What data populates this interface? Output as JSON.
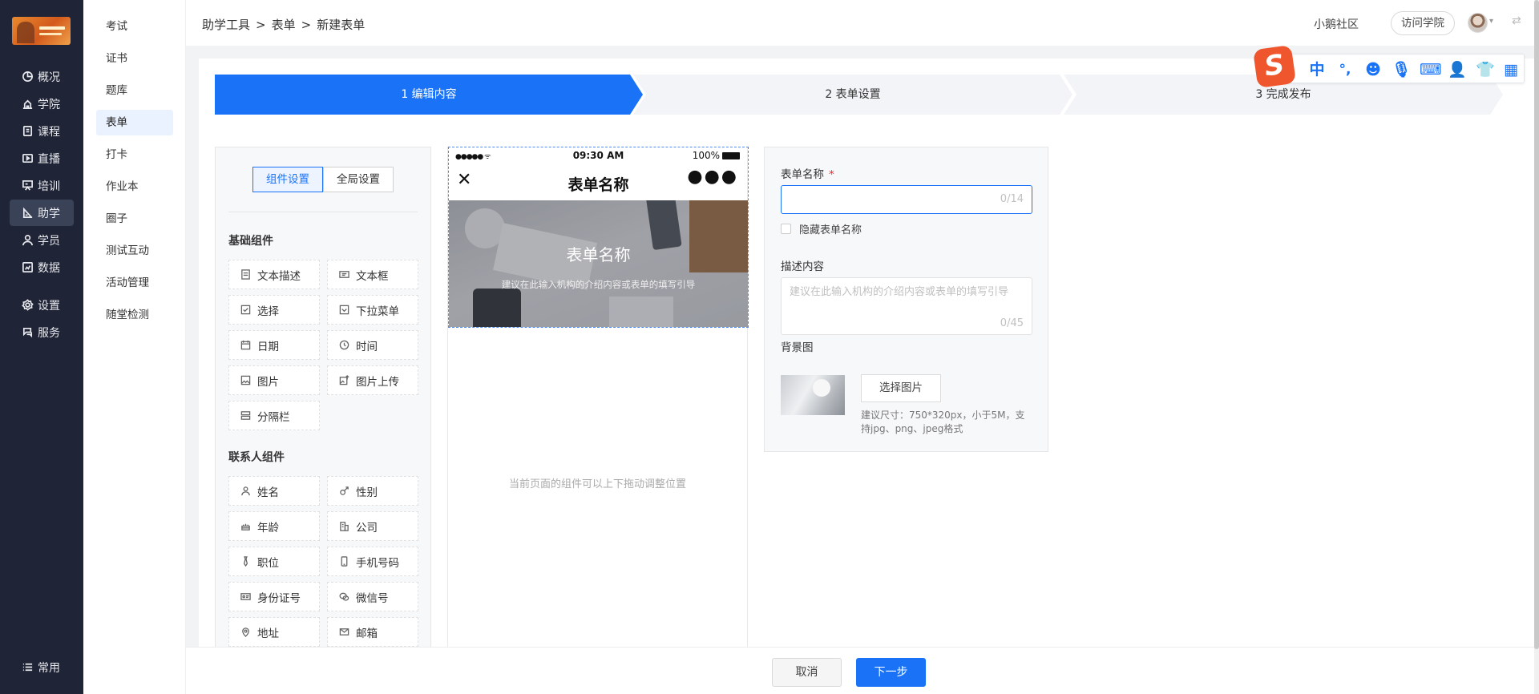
{
  "nav": {
    "items": [
      {
        "label": "概况",
        "icon": "pie-chart-icon"
      },
      {
        "label": "学院",
        "icon": "school-icon"
      },
      {
        "label": "课程",
        "icon": "course-icon"
      },
      {
        "label": "直播",
        "icon": "live-icon"
      },
      {
        "label": "培训",
        "icon": "training-icon"
      },
      {
        "label": "助学",
        "icon": "study-icon"
      },
      {
        "label": "学员",
        "icon": "user-icon"
      },
      {
        "label": "数据",
        "icon": "data-icon"
      },
      {
        "label": "设置",
        "icon": "gear-icon"
      },
      {
        "label": "服务",
        "icon": "service-icon"
      }
    ],
    "active": "助学",
    "bottom_label": "常用"
  },
  "submenu": {
    "items": [
      "考试",
      "证书",
      "题库",
      "表单",
      "打卡",
      "作业本",
      "圈子",
      "测试互动",
      "活动管理",
      "随堂检测"
    ],
    "active": "表单"
  },
  "header": {
    "breadcrumb": [
      "助学工具",
      "表单",
      "新建表单"
    ],
    "community": "小鹅社区",
    "visit_button": "访问学院"
  },
  "steps": [
    "1 编辑内容",
    "2 表单设置",
    "3 完成发布"
  ],
  "components": {
    "tabs": [
      "组件设置",
      "全局设置"
    ],
    "basic_title": "基础组件",
    "basic": [
      "文本描述",
      "文本框",
      "选择",
      "下拉菜单",
      "日期",
      "时间",
      "图片",
      "图片上传",
      "分隔栏"
    ],
    "contact_title": "联系人组件",
    "contact": [
      "姓名",
      "性别",
      "年龄",
      "公司",
      "职位",
      "手机号码",
      "身份证号",
      "微信号",
      "地址",
      "邮箱"
    ]
  },
  "phone": {
    "time": "09:30 AM",
    "battery": "100%",
    "title": "表单名称",
    "banner_title": "表单名称",
    "banner_desc": "建议在此输入机构的介绍内容或表单的填写引导",
    "drag_hint": "当前页面的组件可以上下拖动调整位置"
  },
  "settings": {
    "name_label": "表单名称",
    "required_mark": "*",
    "name_count": "0/14",
    "hide_name": "隐藏表单名称",
    "desc_label": "描述内容",
    "desc_placeholder": "建议在此输入机构的介绍内容或表单的填写引导",
    "desc_count": "0/45",
    "bg_label": "背景图",
    "pick_button": "选择图片",
    "pick_hint": "建议尺寸：750*320px，小于5M，支持jpg、png、jpeg格式"
  },
  "footer": {
    "cancel": "取消",
    "next": "下一步"
  },
  "ime": {
    "lang": "中",
    "punct": "°,"
  },
  "colors": {
    "primary": "#1a73f7",
    "sidebar": "#1f2436",
    "ime_logo": "#f0562e"
  }
}
